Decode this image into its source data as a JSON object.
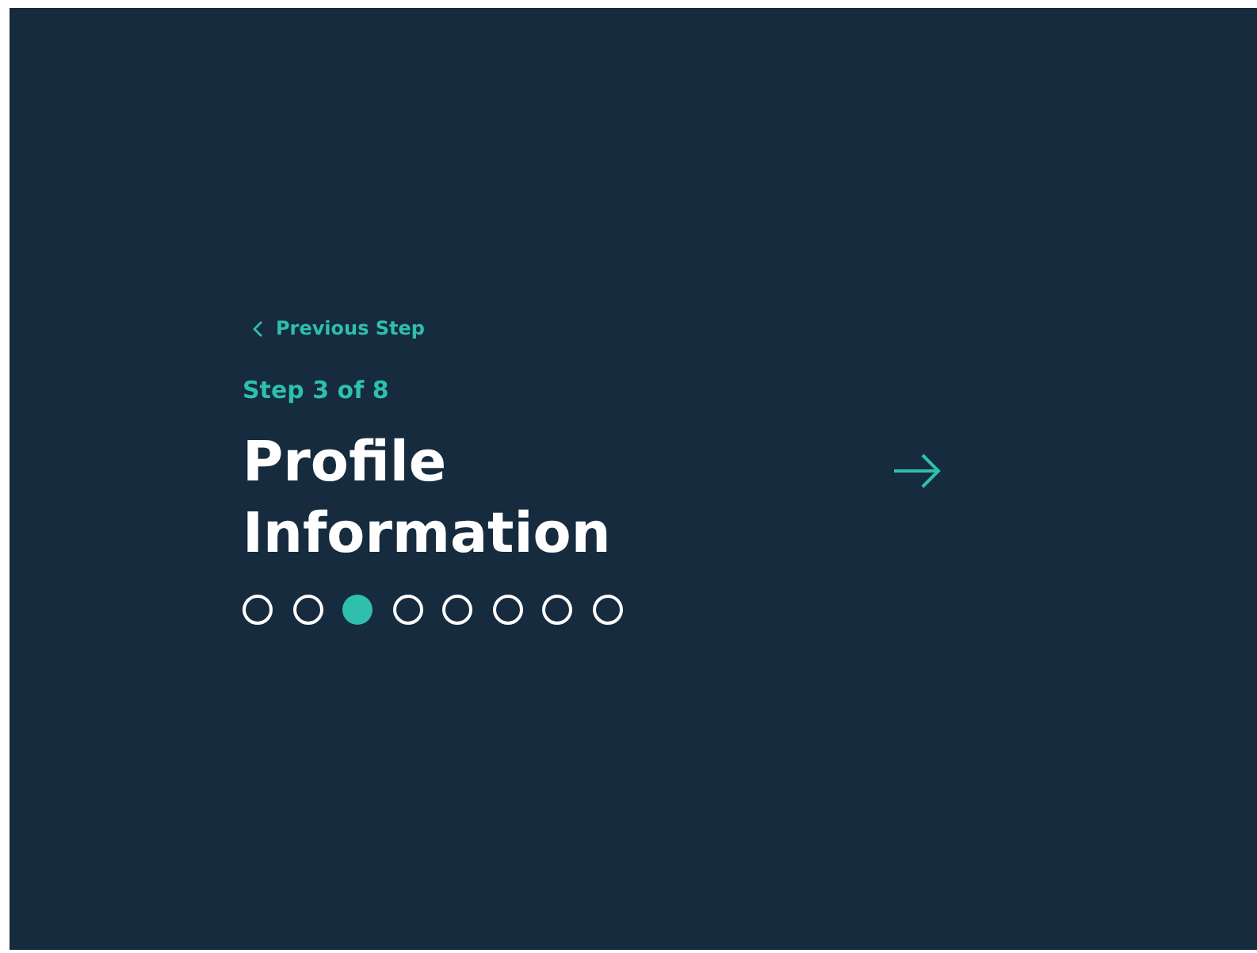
{
  "back_link": {
    "label": "Previous Step"
  },
  "step_label": "Step 3 of 8",
  "title_lines": [
    "Profile",
    "Information"
  ],
  "steps": [
    {
      "selected": false
    },
    {
      "selected": false
    },
    {
      "selected": true
    },
    {
      "selected": false
    },
    {
      "selected": false
    },
    {
      "selected": false
    },
    {
      "selected": false
    },
    {
      "selected": false
    }
  ]
}
